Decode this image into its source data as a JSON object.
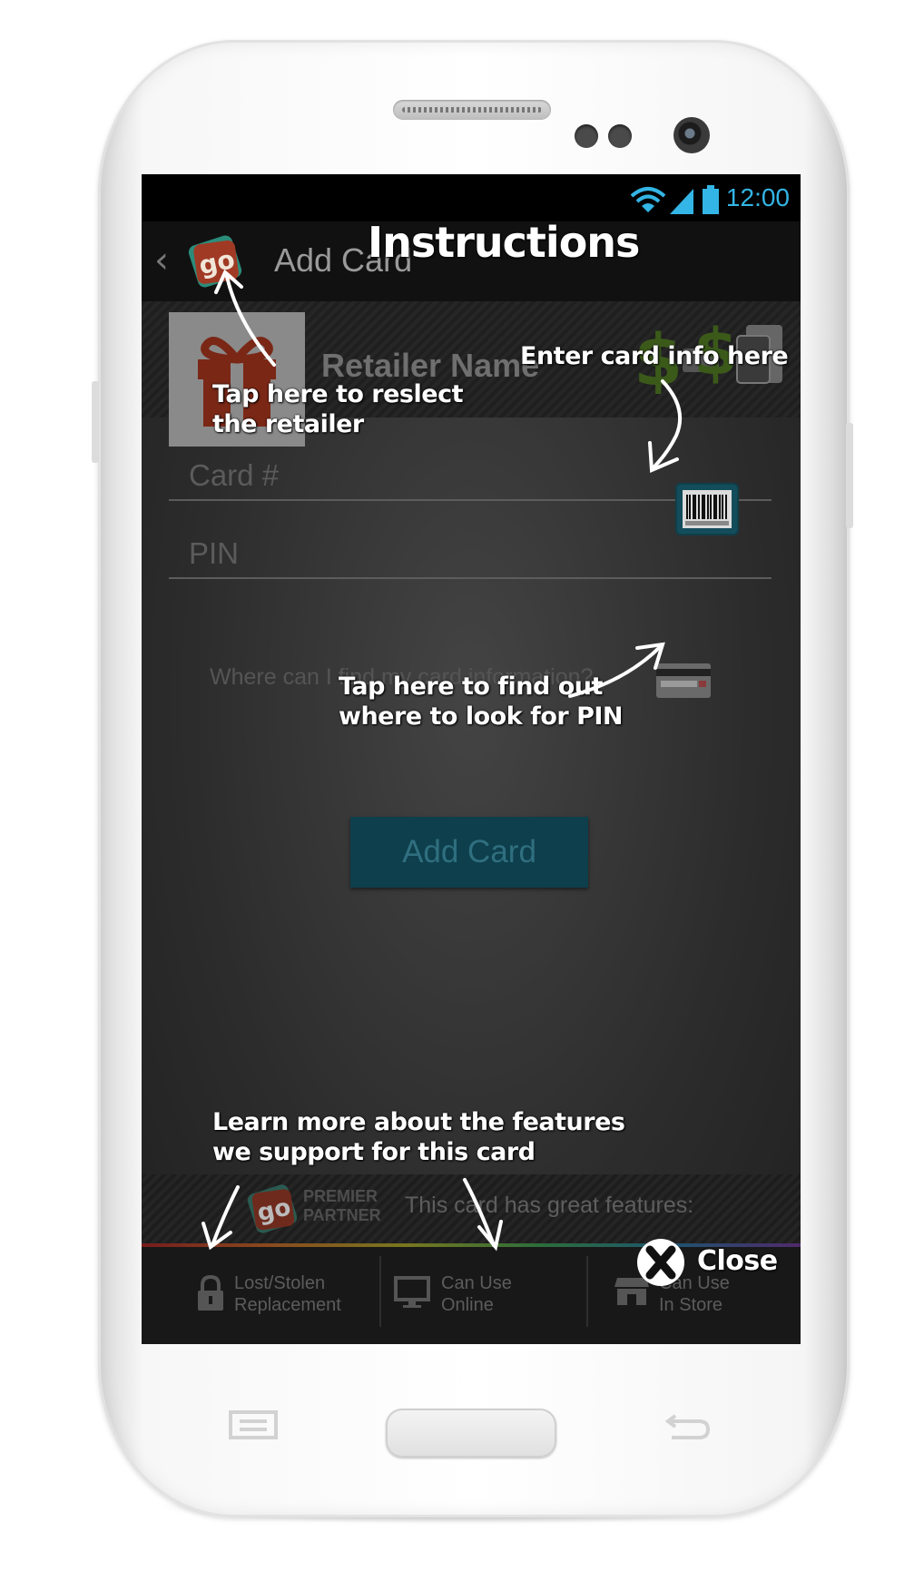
{
  "status_bar": {
    "time": "12:00",
    "accent_color": "#33b5e5"
  },
  "action_bar": {
    "back_icon": "chevron-left-icon",
    "logo_text": "go",
    "title": "Add Card"
  },
  "retailer": {
    "name": "Retailer Name",
    "image_icon": "gift-icon"
  },
  "form": {
    "card_placeholder": "Card #",
    "pin_placeholder": "PIN",
    "where_link": "Where can I find my card information?",
    "add_button": "Add Card"
  },
  "features": {
    "partner_line1": "PREMIER",
    "partner_line2": "PARTNER",
    "headline": "This card has great features:",
    "items": [
      {
        "icon": "lock-icon",
        "line1": "Lost/Stolen",
        "line2": "Replacement"
      },
      {
        "icon": "monitor-icon",
        "line1": "Can Use",
        "line2": "Online"
      },
      {
        "icon": "store-icon",
        "line1": "Can Use",
        "line2": "In Store"
      }
    ]
  },
  "overlay": {
    "title": "Instructions",
    "note_retailer_1": "Tap here to reslect",
    "note_retailer_2": "the retailer",
    "note_card": "Enter card info here",
    "note_pin_1": "Tap here to find out",
    "note_pin_2": "where to look for PIN",
    "note_features_1": "Learn more about the features",
    "note_features_2": "we support for this card",
    "close_label": "Close"
  }
}
